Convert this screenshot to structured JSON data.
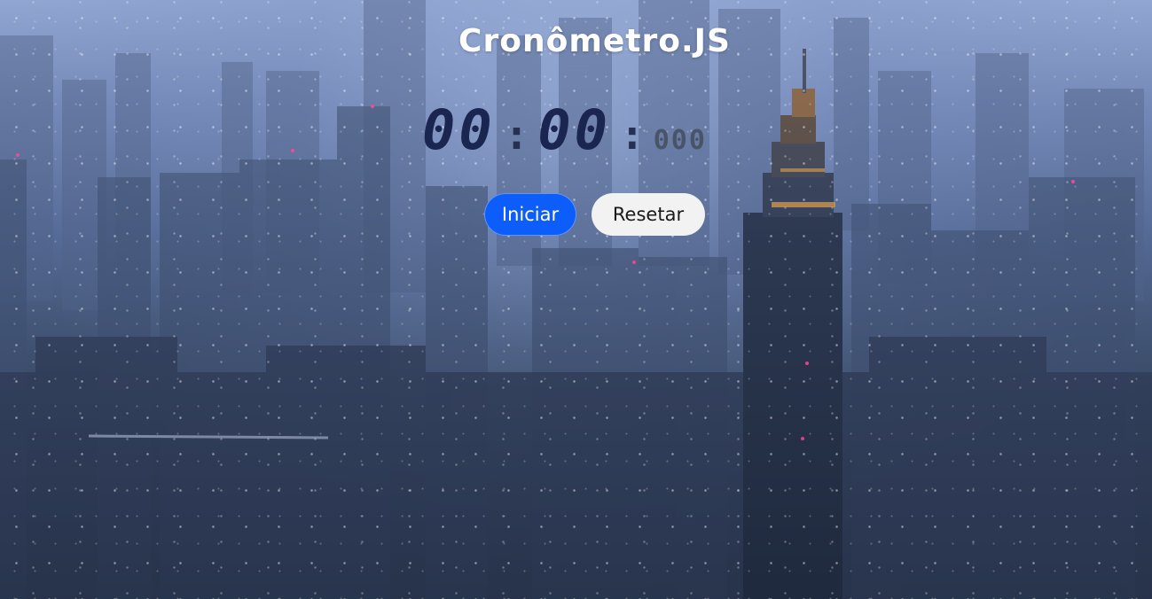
{
  "title": "Cronômetro.JS",
  "timer": {
    "minutes": "00",
    "separator1": ":",
    "seconds": "00",
    "separator2": ":",
    "milliseconds": "000"
  },
  "buttons": {
    "start_label": "Iniciar",
    "reset_label": "Resetar"
  },
  "colors": {
    "start_button": "#0d5dfa",
    "reset_button": "#f2f2f2",
    "title": "#ffffff",
    "digits": "#1a2550"
  }
}
